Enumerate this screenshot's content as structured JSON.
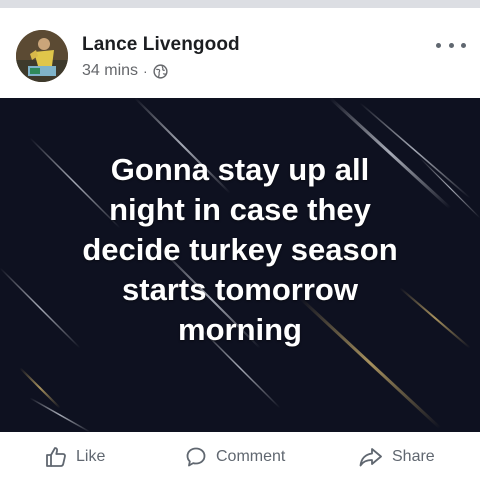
{
  "post": {
    "author": "Lance Livengood",
    "timestamp": "34 mins",
    "separator": "·",
    "privacy_icon": "globe-icon",
    "more_icon": "more-options-icon",
    "image_text_lines": [
      "Gonna stay up all",
      "night in case they",
      "decide turkey season",
      "starts tomorrow",
      "morning"
    ]
  },
  "actions": {
    "like_label": "Like",
    "comment_label": "Comment",
    "share_label": "Share"
  },
  "colors": {
    "image_background": "#0e1120",
    "secondary_text": "#65676b",
    "primary_text": "#1c1e21"
  }
}
